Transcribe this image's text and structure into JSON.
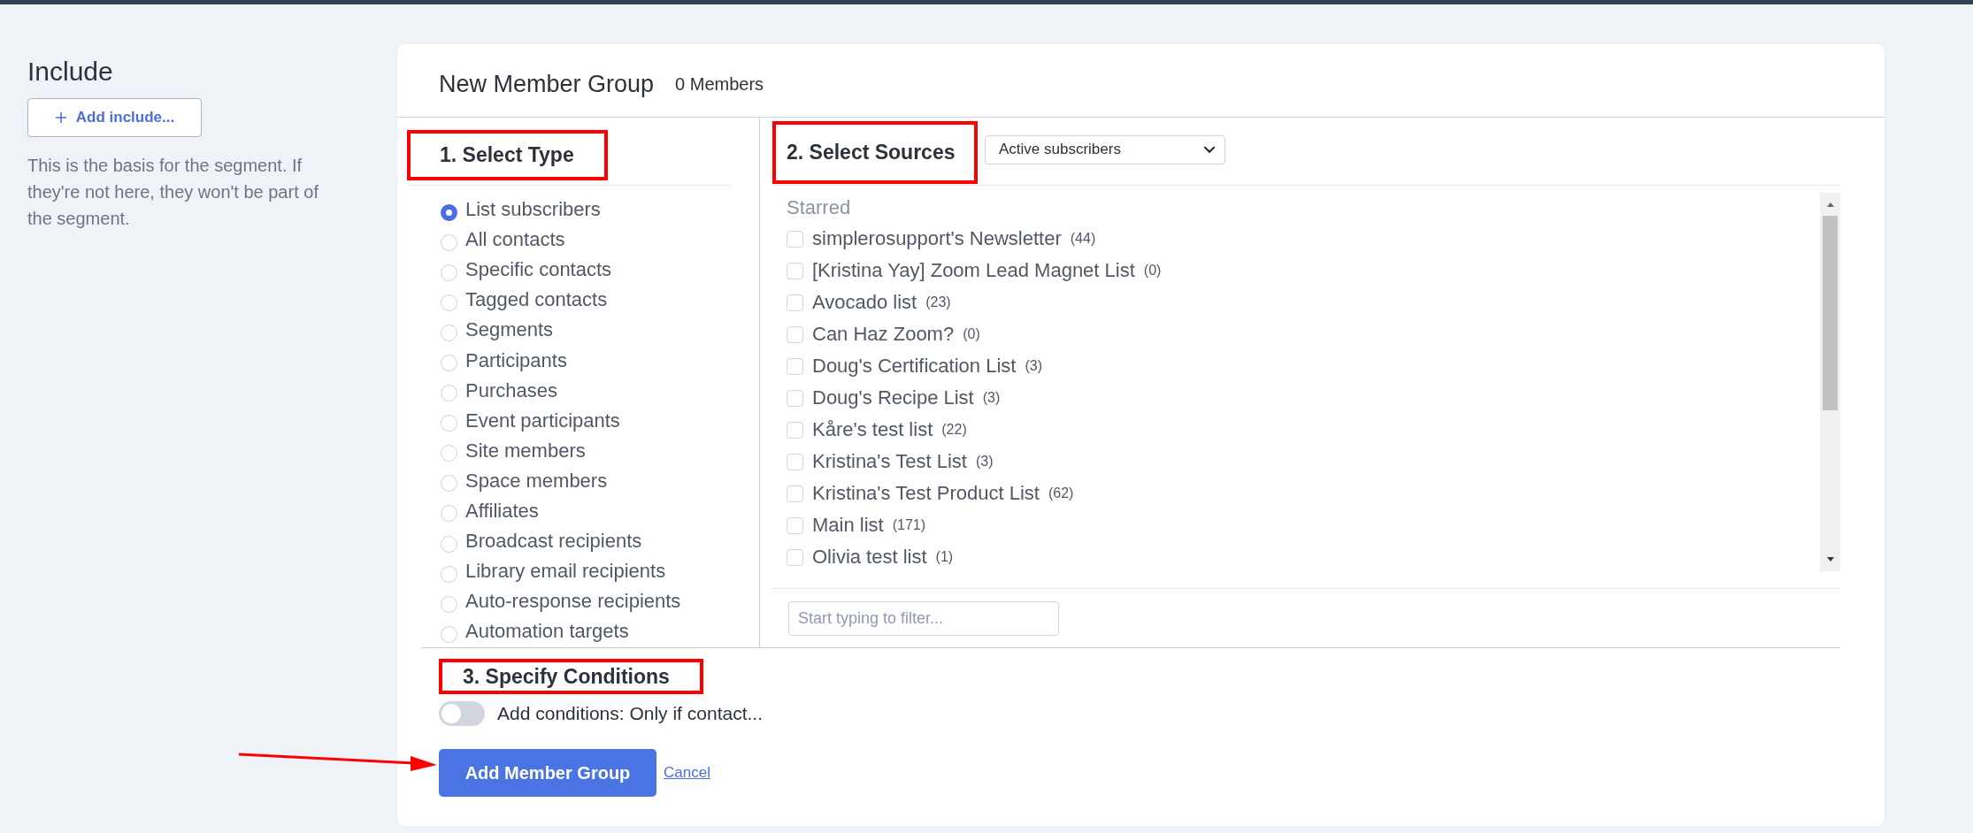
{
  "include": {
    "heading": "Include",
    "add_button": "Add include...",
    "description": "This is the basis for the segment. If they're not here, they won't be part of the segment."
  },
  "card": {
    "title": "New Member Group",
    "member_count": "0 Members",
    "type_section": {
      "heading": "1. Select Type",
      "options": [
        {
          "label": "List subscribers",
          "selected": true
        },
        {
          "label": "All contacts",
          "selected": false
        },
        {
          "label": "Specific contacts",
          "selected": false
        },
        {
          "label": "Tagged contacts",
          "selected": false
        },
        {
          "label": "Segments",
          "selected": false
        },
        {
          "label": "Participants",
          "selected": false
        },
        {
          "label": "Purchases",
          "selected": false
        },
        {
          "label": "Event participants",
          "selected": false
        },
        {
          "label": "Site members",
          "selected": false
        },
        {
          "label": "Space members",
          "selected": false
        },
        {
          "label": "Affiliates",
          "selected": false
        },
        {
          "label": "Broadcast recipients",
          "selected": false
        },
        {
          "label": "Library email recipients",
          "selected": false
        },
        {
          "label": "Auto-response recipients",
          "selected": false
        },
        {
          "label": "Automation targets",
          "selected": false
        }
      ]
    },
    "sources_section": {
      "heading": "2. Select Sources",
      "status_select": {
        "value": "Active subscribers"
      },
      "group_label": "Starred",
      "sources": [
        {
          "name": "simplerosupport's Newsletter",
          "count": "(44)",
          "checked": false
        },
        {
          "name": "[Kristina Yay] Zoom Lead Magnet List",
          "count": "(0)",
          "checked": false
        },
        {
          "name": "Avocado list",
          "count": "(23)",
          "checked": false
        },
        {
          "name": "Can Haz Zoom?",
          "count": "(0)",
          "checked": false
        },
        {
          "name": "Doug's Certification List",
          "count": "(3)",
          "checked": false
        },
        {
          "name": "Doug's Recipe List",
          "count": "(3)",
          "checked": false
        },
        {
          "name": "Kåre's test list",
          "count": "(22)",
          "checked": false
        },
        {
          "name": "Kristina's Test List",
          "count": "(3)",
          "checked": false
        },
        {
          "name": "Kristina's Test Product List",
          "count": "(62)",
          "checked": false
        },
        {
          "name": "Main list",
          "count": "(171)",
          "checked": false
        },
        {
          "name": "Olivia test list",
          "count": "(1)",
          "checked": false
        }
      ],
      "filter": {
        "placeholder": "Start typing to filter..."
      }
    },
    "conditions_section": {
      "heading": "3. Specify Conditions",
      "toggle": {
        "label": "Add conditions: Only if contact...",
        "on": false
      }
    },
    "actions": {
      "submit": "Add Member Group",
      "cancel": "Cancel"
    }
  }
}
